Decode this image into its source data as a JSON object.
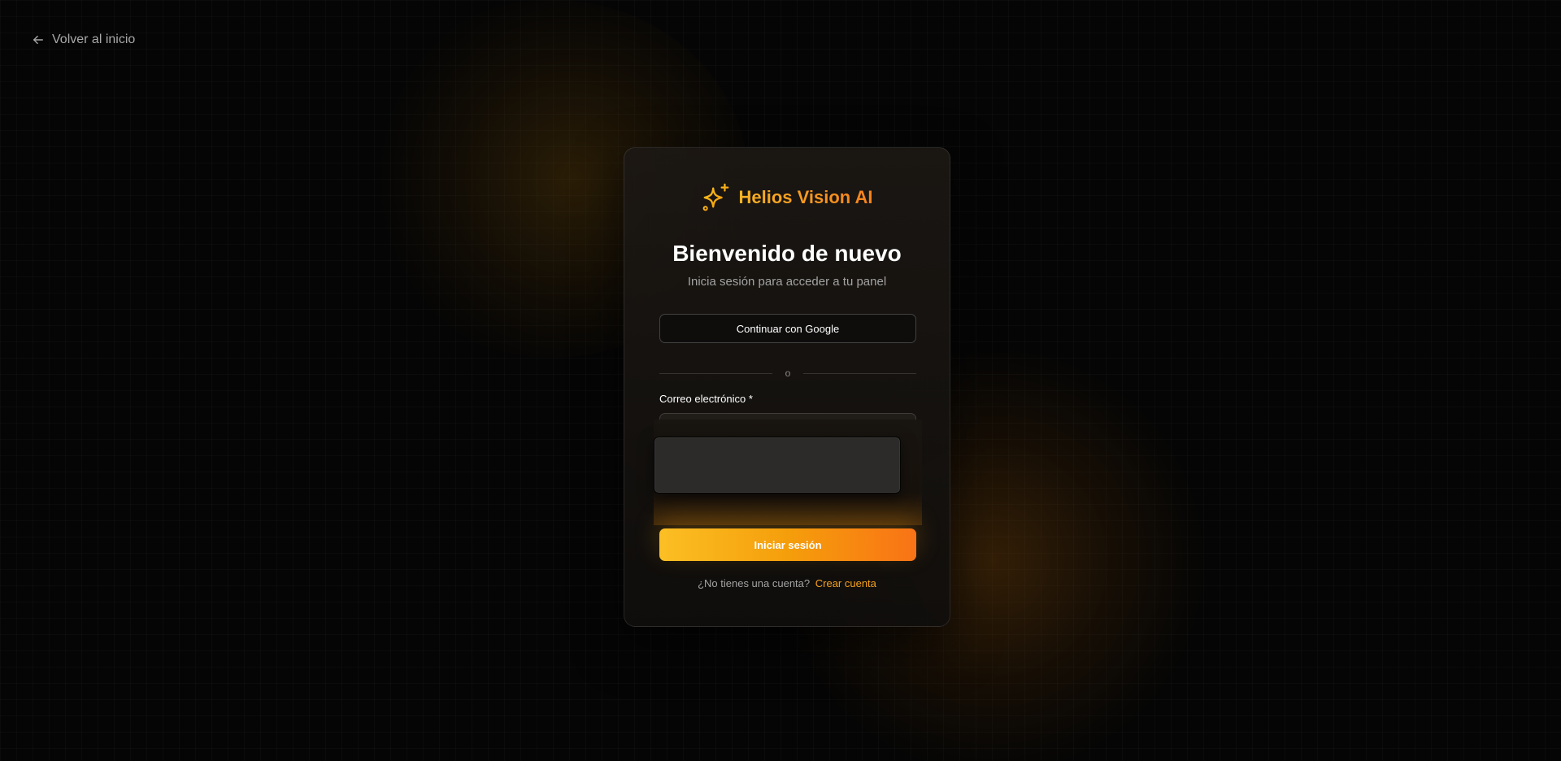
{
  "nav": {
    "back_label": "Volver al inicio"
  },
  "brand": {
    "name": "Helios Vision AI",
    "icon": "sparkles-icon",
    "accent_from": "#f9b224",
    "accent_to": "#f6811e"
  },
  "login": {
    "title": "Bienvenido de nuevo",
    "subtitle": "Inicia sesión para acceder a tu panel",
    "google_label": "Continuar con Google",
    "divider_label": "o",
    "email_label": "Correo electrónico *",
    "submit_label": "Iniciar sesión",
    "no_account_text": "¿No tienes una cuenta?",
    "create_account_label": "Crear cuenta"
  }
}
